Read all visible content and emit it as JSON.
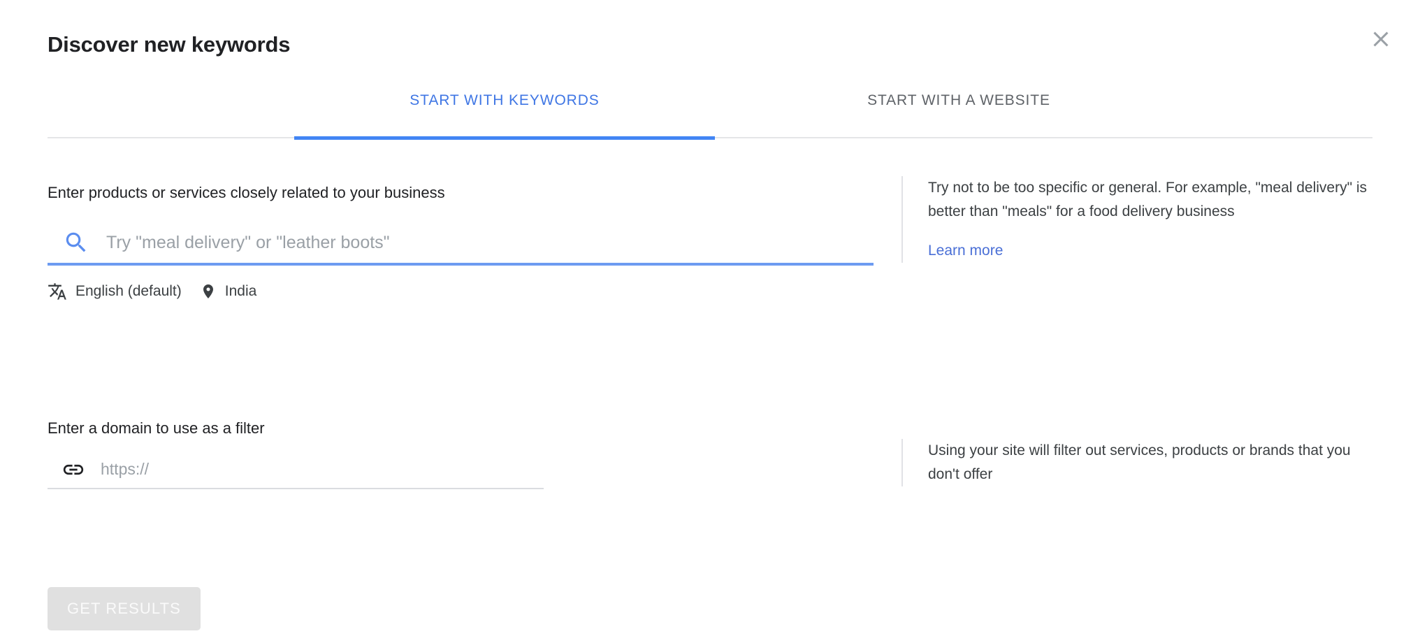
{
  "dialog": {
    "title": "Discover new keywords",
    "close_label": "Close"
  },
  "tabs": [
    {
      "label": "START WITH KEYWORDS",
      "active": true
    },
    {
      "label": "START WITH A WEBSITE",
      "active": false
    }
  ],
  "keywords_section": {
    "label": "Enter products or services closely related to your business",
    "placeholder": "Try \"meal delivery\" or \"leather boots\"",
    "value": "",
    "language": "English (default)",
    "location": "India"
  },
  "domain_section": {
    "label": "Enter a domain to use as a filter",
    "placeholder": "https://",
    "value": ""
  },
  "help": {
    "keywords_text": "Try not to be too specific or general. For example, \"meal delivery\" is better than \"meals\" for a food delivery business",
    "learn_more": "Learn more",
    "domain_text": "Using your site will filter out services, products or brands that you don't offer"
  },
  "actions": {
    "submit_label": "GET RESULTS"
  },
  "colors": {
    "accent": "#4285f4",
    "tab_active_text": "#3f76e4",
    "tab_inactive_text": "#5f6368",
    "link": "#4a6fd6",
    "title_text": "#202124",
    "muted_text": "#5f6368",
    "placeholder": "#9aa0a6",
    "divider": "#e1e2e6",
    "button_disabled_bg": "#e0e0e0"
  }
}
